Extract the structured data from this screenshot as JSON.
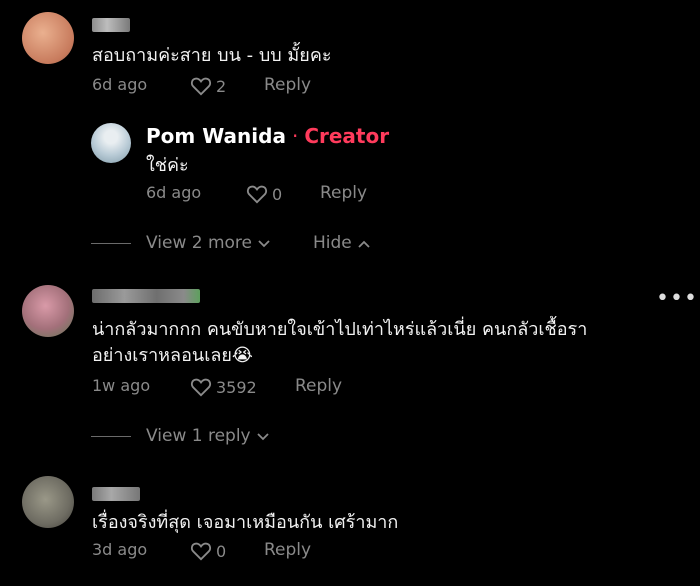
{
  "comments": [
    {
      "text": "สอบถามค่ะสาย บน - บบ มั้ยคะ",
      "time": "6d ago",
      "likes": "2",
      "reply_label": "Reply",
      "avatar_colors": [
        "#e6a27f",
        "#c97c5d"
      ],
      "name_color": "#9a9a9a",
      "replies": [
        {
          "author": "Pom Wanida",
          "separator": "·",
          "badge": "Creator",
          "text": "ใช่ค่ะ",
          "time": "6d ago",
          "likes": "0",
          "reply_label": "Reply",
          "avatar_colors": [
            "#a9c6d6",
            "#d9e4ea"
          ]
        }
      ],
      "view_more_label": "View 2 more",
      "hide_label": "Hide"
    },
    {
      "text_line1": "น่ากลัวมากกก คนขับหายใจเข้าไปเท่าไหร่แล้วเนี่ย คนกลัวเชื้อรา",
      "text_line2": "อย่างเราหลอนเลย",
      "emoji": "😭",
      "time": "1w ago",
      "likes": "3592",
      "reply_label": "Reply",
      "view_reply_label": "View 1 reply",
      "avatar_colors": [
        "#c98a96",
        "#7e9a6e"
      ],
      "name_color": "#6f6f6f"
    },
    {
      "text": "เรื่องจริงที่สุด เจอมาเหมือนกัน เศร้ามาก",
      "time": "3d ago",
      "likes": "0",
      "reply_label": "Reply",
      "avatar_colors": [
        "#8a8a7a",
        "#5c5a52"
      ],
      "name_color": "#8a8a8a"
    }
  ],
  "more_menu_glyph": "•••"
}
